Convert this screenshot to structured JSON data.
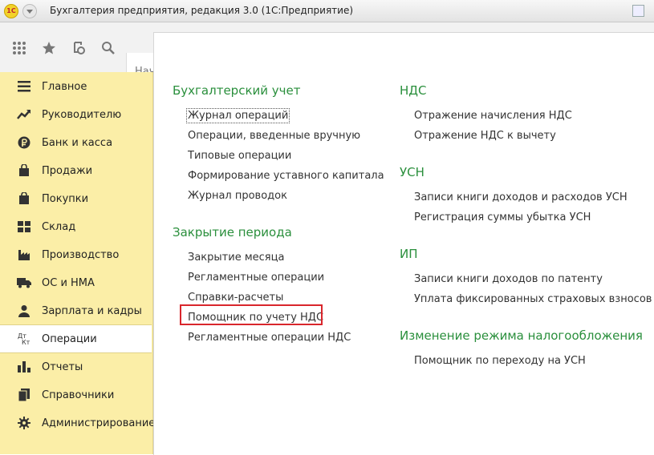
{
  "window": {
    "title": "Бухгалтерия предприятия, редакция 3.0  (1С:Предприятие)",
    "logo_text": "1С"
  },
  "toolbar": {
    "icons": [
      "grid-icon",
      "star-icon",
      "history-icon",
      "search-icon"
    ],
    "start_tab_label": "Нач"
  },
  "sidebar": {
    "items": [
      {
        "label": "Главное",
        "icon": "menu-icon"
      },
      {
        "label": "Руководителю",
        "icon": "trend-icon"
      },
      {
        "label": "Банк и касса",
        "icon": "ruble-icon"
      },
      {
        "label": "Продажи",
        "icon": "bag-icon"
      },
      {
        "label": "Покупки",
        "icon": "cart-icon"
      },
      {
        "label": "Склад",
        "icon": "warehouse-icon"
      },
      {
        "label": "Производство",
        "icon": "factory-icon"
      },
      {
        "label": "ОС и НМА",
        "icon": "truck-icon"
      },
      {
        "label": "Зарплата и кадры",
        "icon": "person-icon"
      },
      {
        "label": "Операции",
        "icon": "operations-icon",
        "active": true
      },
      {
        "label": "Отчеты",
        "icon": "bar-chart-icon"
      },
      {
        "label": "Справочники",
        "icon": "book-icon"
      },
      {
        "label": "Администрирование",
        "icon": "gear-icon"
      }
    ]
  },
  "main": {
    "left": {
      "sections": [
        {
          "title": "Бухгалтерский учет",
          "links": [
            "Журнал операций",
            "Операции, введенные вручную",
            "Типовые операции",
            "Формирование уставного капитала",
            "Журнал проводок"
          ]
        },
        {
          "title": "Закрытие периода",
          "links": [
            "Закрытие месяца",
            "Регламентные операции",
            "Справки-расчеты",
            "Помощник по учету НДС",
            "Регламентные операции НДС"
          ]
        }
      ]
    },
    "right": {
      "sections": [
        {
          "title": "НДС",
          "links": [
            "Отражение начисления НДС",
            "Отражение НДС к вычету"
          ]
        },
        {
          "title": "УСН",
          "links": [
            "Записи книги доходов и расходов УСН",
            "Регистрация суммы убытка УСН"
          ]
        },
        {
          "title": "ИП",
          "links": [
            "Записи книги доходов по патенту",
            "Уплата фиксированных страховых взносов"
          ]
        },
        {
          "title": "Изменение режима налогообложения",
          "links": [
            "Помощник по переходу на УСН"
          ]
        }
      ]
    }
  },
  "colors": {
    "sidebar_bg": "#fbeea7",
    "section_title": "#2a8f3c",
    "highlight_border": "#d9262c"
  }
}
